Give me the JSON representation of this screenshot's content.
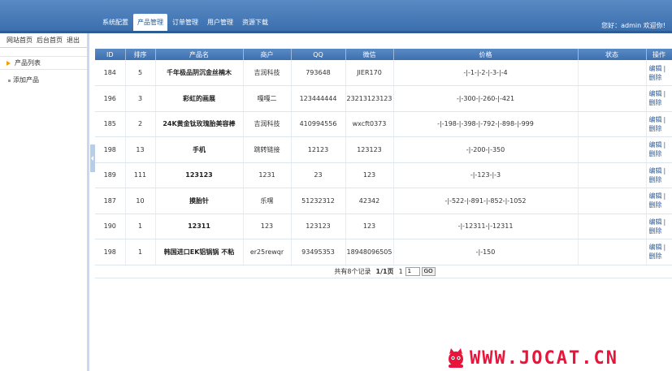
{
  "header": {
    "nav": [
      "系统配置",
      "产品管理",
      "订单管理",
      "用户管理",
      "资源下载"
    ],
    "active_index": 1,
    "welcome_prefix": "您好：",
    "username": "admin",
    "welcome_suffix": "欢迎你!"
  },
  "sidebar": {
    "quick_links": [
      "网站首页",
      "后台首页",
      "退出"
    ],
    "items": [
      "产品列表",
      "添加产品"
    ]
  },
  "table": {
    "columns": [
      "ID",
      "排序",
      "产品名",
      "商户",
      "QQ",
      "微信",
      "价格",
      "状态",
      "操作"
    ],
    "rows": [
      {
        "id": "184",
        "sort": "5",
        "name": "千年极品阴沉金丝楠木",
        "merchant": "吉润科技",
        "qq": "793648",
        "wechat": "JIER170",
        "price": "-|-1-|-2-|-3-|-4",
        "status": ""
      },
      {
        "id": "196",
        "sort": "3",
        "name": "彩虹的画展",
        "merchant": "嘎嘎二",
        "qq": "123444444",
        "wechat": "23213123123",
        "price": "-|-300-|-260-|-421",
        "status": ""
      },
      {
        "id": "185",
        "sort": "2",
        "name": "24K黄金钛玫瑰胎美容棒",
        "merchant": "吉润科技",
        "qq": "410994556",
        "wechat": "wxcft0373",
        "price": "-|-198-|-398-|-792-|-898-|-999",
        "status": ""
      },
      {
        "id": "198",
        "sort": "13",
        "name": "手机",
        "merchant": "跳转链接",
        "qq": "12123",
        "wechat": "123123",
        "price": "-|-200-|-350",
        "status": ""
      },
      {
        "id": "189",
        "sort": "111",
        "name": "123123",
        "merchant": "1231",
        "qq": "23",
        "wechat": "123",
        "price": "-|-123-|-3",
        "status": ""
      },
      {
        "id": "187",
        "sort": "10",
        "name": "摸胎针",
        "merchant": "乐嘿",
        "qq": "51232312",
        "wechat": "42342",
        "price": "-|-522-|-891-|-852-|-1052",
        "status": ""
      },
      {
        "id": "190",
        "sort": "1",
        "name": "12311",
        "merchant": "123",
        "qq": "123123",
        "wechat": "123",
        "price": "-|-12311-|-12311",
        "status": ""
      },
      {
        "id": "198",
        "sort": "1",
        "name": "韩国进口EK铝锅锅 不粘",
        "merchant": "er25rewqr",
        "qq": "93495353",
        "wechat": "18948096505",
        "price": "-|-150",
        "status": ""
      }
    ],
    "edit_label": "编辑",
    "delete_label": "删除"
  },
  "pager": {
    "total_text": "共有8个记录",
    "page_text": "1/1页",
    "page_num": "1",
    "input_value": "1",
    "go_label": "GO"
  },
  "watermark": {
    "text": "WWW.JOCAT.CN"
  },
  "colors": {
    "header": "#3b6fae",
    "accent": "#f2a000",
    "watermark": "#e8143c"
  }
}
